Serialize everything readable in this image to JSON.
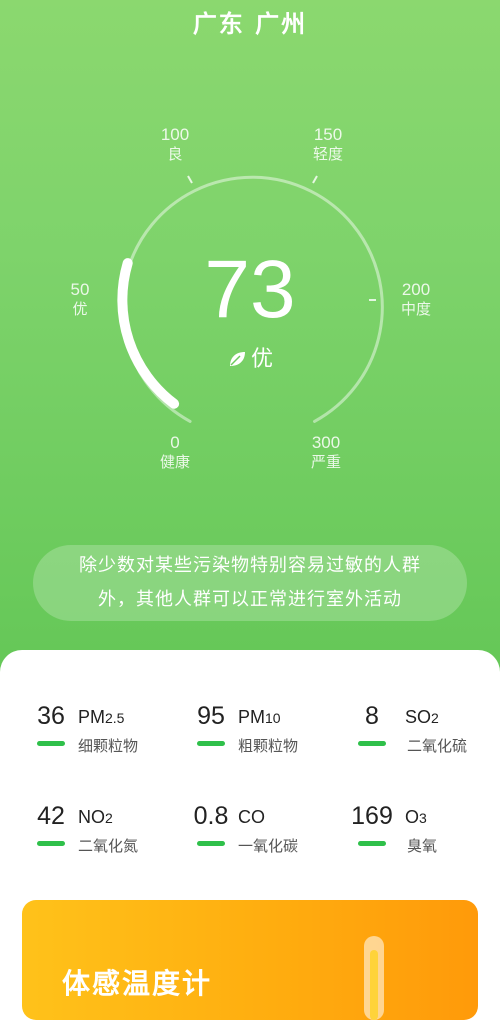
{
  "location": {
    "city": "广东 广州"
  },
  "aqi": {
    "value": "73",
    "level": "优",
    "fraction": 0.243,
    "scale": [
      {
        "num": "0",
        "label": "健康"
      },
      {
        "num": "50",
        "label": "优"
      },
      {
        "num": "100",
        "label": "良"
      },
      {
        "num": "150",
        "label": "轻度"
      },
      {
        "num": "200",
        "label": "中度"
      },
      {
        "num": "300",
        "label": "严重"
      }
    ]
  },
  "advice": {
    "line1": "除少数对某些污染物特别容易过敏的人群",
    "line2": "外，其他人群可以正常进行室外活动"
  },
  "pollutants": [
    {
      "value": "36",
      "code": "PM",
      "sub": "2.5",
      "name": "细颗粒物"
    },
    {
      "value": "95",
      "code": "PM",
      "sub": "10",
      "name": "粗颗粒物"
    },
    {
      "value": "8",
      "code": "SO",
      "sub": "2",
      "name": "二氧化硫"
    },
    {
      "value": "42",
      "code": "NO",
      "sub": "2",
      "name": "二氧化氮"
    },
    {
      "value": "0.8",
      "code": "CO",
      "sub": "",
      "name": "一氧化碳"
    },
    {
      "value": "169",
      "code": "O",
      "sub": "3",
      "name": "臭氧"
    }
  ],
  "feels_like": {
    "title": "体感温度计"
  },
  "colors": {
    "good": "#2fc04a",
    "header_green": "#7ed36b",
    "feels_orange": "#ffad0f"
  }
}
